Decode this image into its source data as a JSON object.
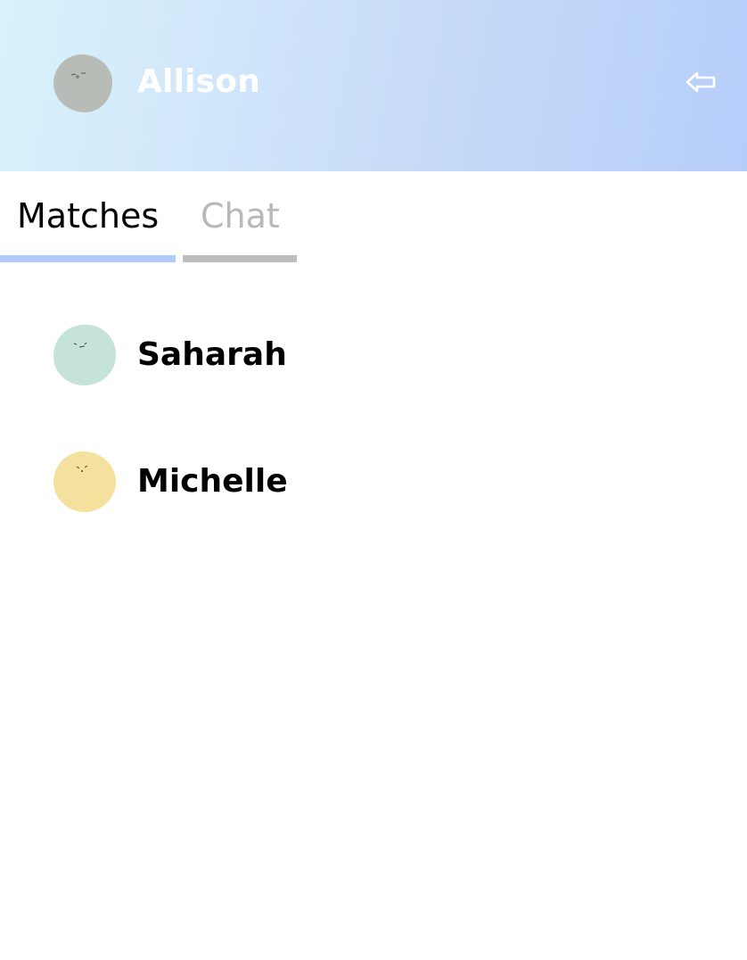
{
  "header": {
    "user_name": "Allison",
    "avatar_color": "#b7bdb6",
    "logout_icon": "logout-arrow-icon"
  },
  "tabs": [
    {
      "label": "Matches",
      "active": true,
      "indicator_color": "#b3cbf8"
    },
    {
      "label": "Chat",
      "active": false,
      "indicator_color": "#bdbdbd"
    }
  ],
  "matches": [
    {
      "name": "Saharah",
      "avatar_color": "#c6e3d8"
    },
    {
      "name": "Michelle",
      "avatar_color": "#f5e19e"
    }
  ],
  "colors": {
    "header_gradient_start": "#daf2fc",
    "header_gradient_end": "#b5cdf9",
    "inactive_tab_text": "#b8b8b8"
  }
}
